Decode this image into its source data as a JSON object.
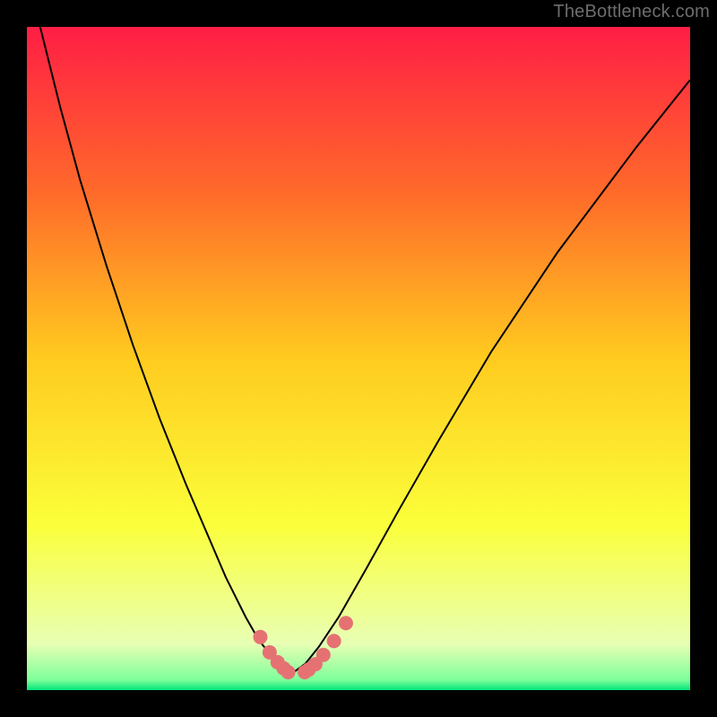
{
  "watermark": "TheBottleneck.com",
  "chart_data": {
    "type": "line",
    "title": "",
    "xlabel": "",
    "ylabel": "",
    "xlim": [
      0,
      100
    ],
    "ylim": [
      100,
      0
    ],
    "grid": false,
    "series": [
      {
        "name": "curve",
        "x": [
          2,
          5,
          8,
          12,
          16,
          20,
          24,
          27,
          30,
          33,
          35,
          37,
          38.5,
          39.5,
          40.5,
          42,
          44,
          47,
          51,
          56,
          62,
          70,
          80,
          92,
          100
        ],
        "y": [
          0,
          12,
          23,
          36,
          48,
          59,
          69,
          76,
          83,
          89,
          92.5,
          95,
          96.5,
          97.3,
          97.1,
          96,
          93.5,
          89,
          82,
          73,
          62.5,
          49,
          34,
          18,
          8
        ]
      }
    ],
    "markers": {
      "name": "dots",
      "x": [
        35.2,
        36.6,
        37.8,
        38.7,
        39.4,
        41.9,
        42.5,
        43.5,
        44.7,
        46.3,
        48.1
      ],
      "y": [
        92.0,
        94.3,
        95.8,
        96.7,
        97.3,
        97.3,
        96.9,
        96.1,
        94.7,
        92.6,
        89.9
      ]
    },
    "gradient_stops": [
      {
        "offset": 0,
        "color": "#ff1e45"
      },
      {
        "offset": 0.25,
        "color": "#ff6a2a"
      },
      {
        "offset": 0.5,
        "color": "#ffcb1f"
      },
      {
        "offset": 0.75,
        "color": "#fbff3a"
      },
      {
        "offset": 0.93,
        "color": "#e8ffb4"
      },
      {
        "offset": 0.985,
        "color": "#7cff9a"
      },
      {
        "offset": 1.0,
        "color": "#00e37a"
      }
    ],
    "marker_color": "#e67173",
    "curve_color": "#000000"
  }
}
